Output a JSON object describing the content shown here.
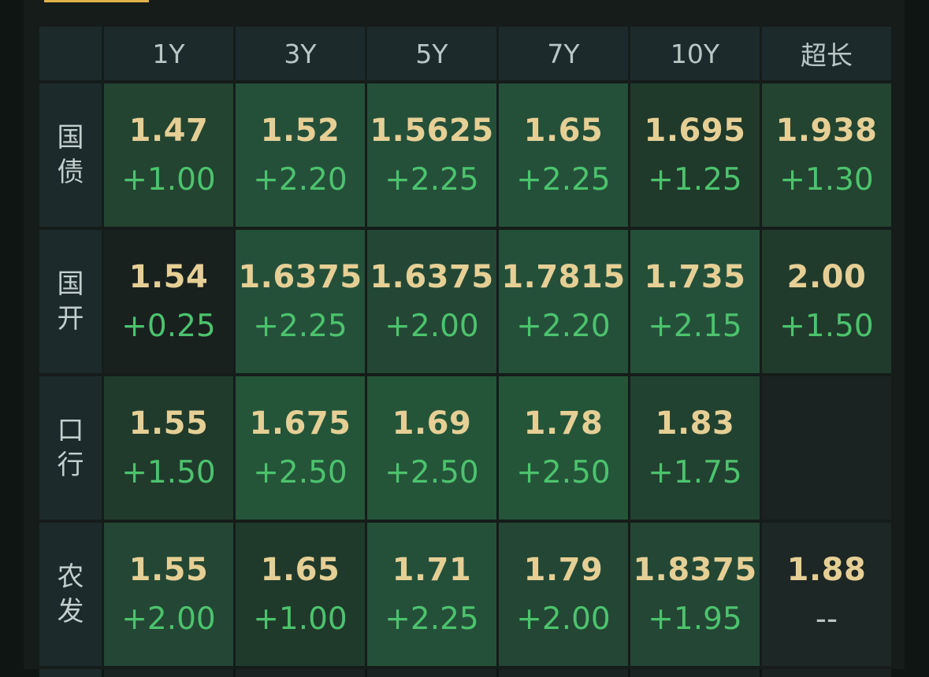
{
  "header": {
    "tenors": [
      "1Y",
      "3Y",
      "5Y",
      "7Y",
      "10Y",
      "超长"
    ]
  },
  "rows": [
    {
      "label": [
        "国",
        "债"
      ],
      "cells": [
        {
          "yield": "1.47",
          "change": "+1.00",
          "color": "#234430"
        },
        {
          "yield": "1.52",
          "change": "+2.20",
          "color": "#24503a"
        },
        {
          "yield": "1.5625",
          "change": "+2.25",
          "color": "#24503a"
        },
        {
          "yield": "1.65",
          "change": "+2.25",
          "color": "#24503a"
        },
        {
          "yield": "1.695",
          "change": "+1.25",
          "color": "#1f3a2b"
        },
        {
          "yield": "1.938",
          "change": "+1.30",
          "color": "#234430"
        }
      ]
    },
    {
      "label": [
        "国",
        "开"
      ],
      "cells": [
        {
          "yield": "1.54",
          "change": "+0.25",
          "color": "#19211f"
        },
        {
          "yield": "1.6375",
          "change": "+2.25",
          "color": "#24503a"
        },
        {
          "yield": "1.6375",
          "change": "+2.00",
          "color": "#234734"
        },
        {
          "yield": "1.7815",
          "change": "+2.20",
          "color": "#24503a"
        },
        {
          "yield": "1.735",
          "change": "+2.15",
          "color": "#24503a"
        },
        {
          "yield": "2.00",
          "change": "+1.50",
          "color": "#203b2c"
        }
      ]
    },
    {
      "label": [
        "口",
        "行"
      ],
      "cells": [
        {
          "yield": "1.55",
          "change": "+1.50",
          "color": "#203b2c"
        },
        {
          "yield": "1.675",
          "change": "+2.50",
          "color": "#245539"
        },
        {
          "yield": "1.69",
          "change": "+2.50",
          "color": "#245539"
        },
        {
          "yield": "1.78",
          "change": "+2.50",
          "color": "#245539"
        },
        {
          "yield": "1.83",
          "change": "+1.75",
          "color": "#214230"
        },
        {
          "yield": "",
          "change": "",
          "color": "#1a2321"
        }
      ]
    },
    {
      "label": [
        "农",
        "发"
      ],
      "cells": [
        {
          "yield": "1.55",
          "change": "+2.00",
          "color": "#234734"
        },
        {
          "yield": "1.65",
          "change": "+1.00",
          "color": "#1f3a2b"
        },
        {
          "yield": "1.71",
          "change": "+2.25",
          "color": "#24503a"
        },
        {
          "yield": "1.79",
          "change": "+2.00",
          "color": "#234734"
        },
        {
          "yield": "1.8375",
          "change": "+1.95",
          "color": "#234734"
        },
        {
          "yield": "1.88",
          "change": "--",
          "color": "#1d2725"
        }
      ]
    }
  ],
  "colors": {
    "yield_text": "#e6cf95",
    "change_up": "#4cc36d",
    "header_bg": "#1d2a2c",
    "accent": "#e2b24a"
  }
}
